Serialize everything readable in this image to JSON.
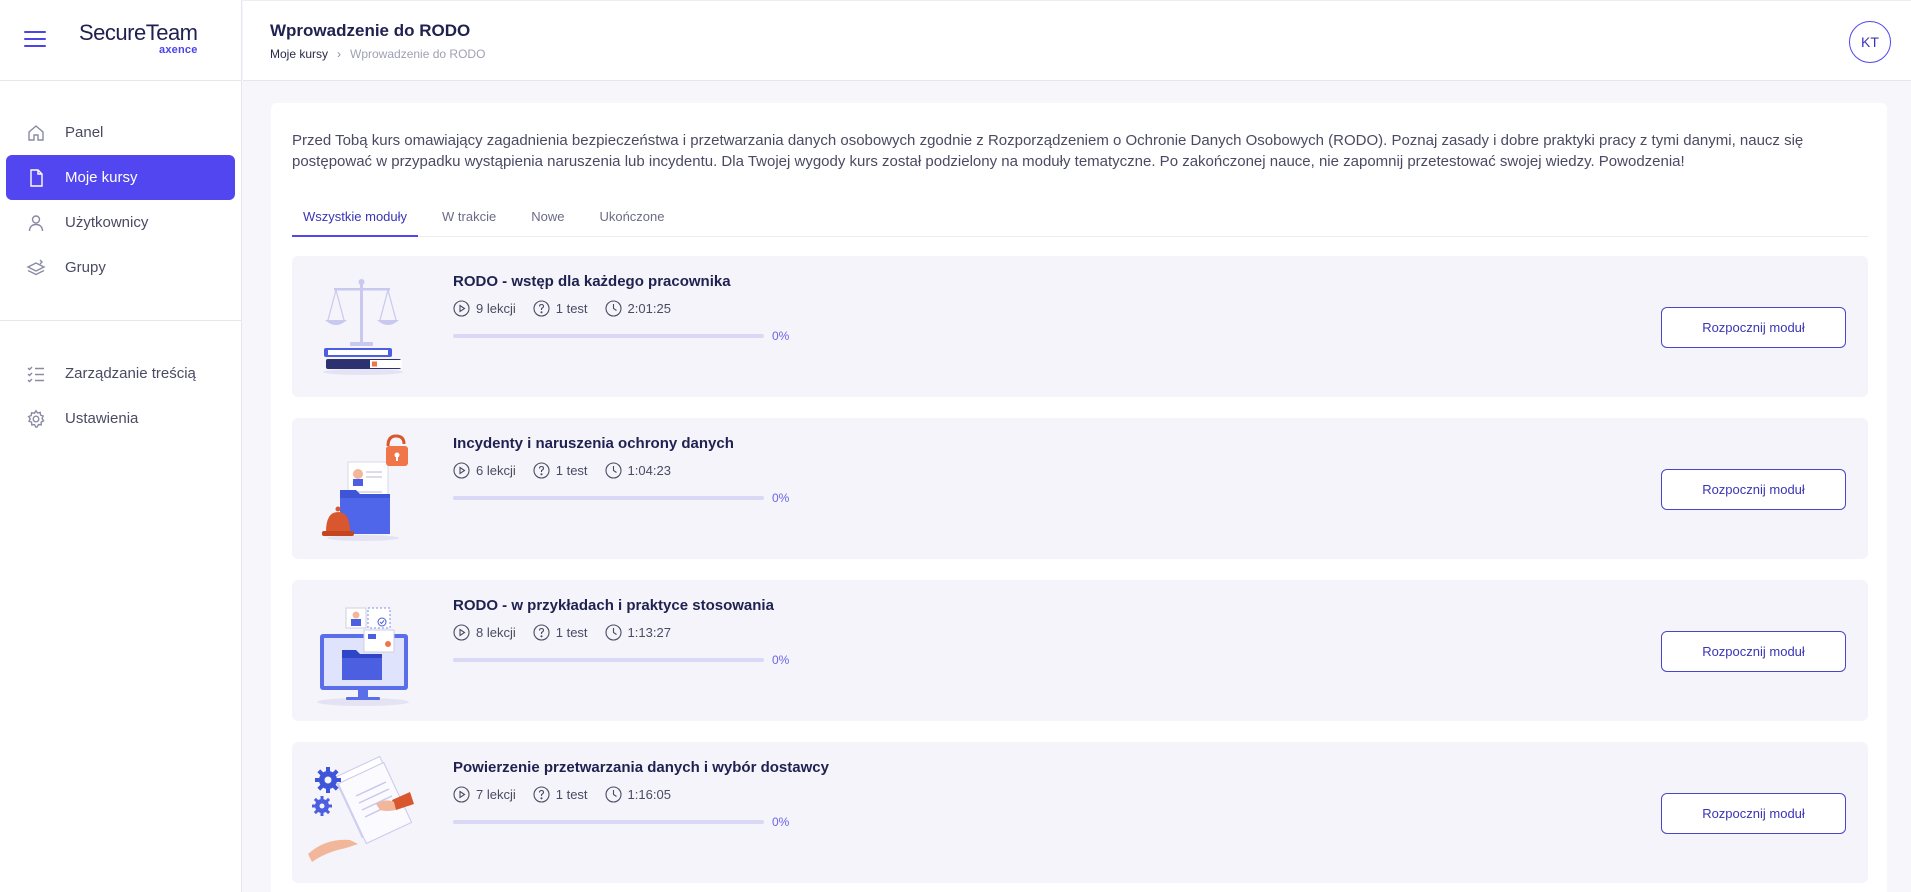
{
  "app": {
    "logo_main": "SecureTeam",
    "logo_sub": "axence"
  },
  "sidebar": {
    "items": [
      {
        "label": "Panel",
        "icon": "home-icon"
      },
      {
        "label": "Moje kursy",
        "icon": "document-icon",
        "active": true
      },
      {
        "label": "Użytkownicy",
        "icon": "user-icon"
      },
      {
        "label": "Grupy",
        "icon": "layers-icon"
      }
    ],
    "items2": [
      {
        "label": "Zarządzanie treścią",
        "icon": "list-check-icon"
      },
      {
        "label": "Ustawienia",
        "icon": "gear-icon"
      }
    ]
  },
  "header": {
    "title": "Wprowadzenie do RODO",
    "breadcrumb_root": "Moje kursy",
    "breadcrumb_sep": "›",
    "breadcrumb_current": "Wprowadzenie do RODO",
    "avatar_initials": "KT"
  },
  "main": {
    "intro": "Przed Tobą kurs omawiający zagadnienia bezpieczeństwa i przetwarzania danych osobowych zgodnie z Rozporządzeniem o Ochronie Danych Osobowych (RODO). Poznaj zasady i dobre praktyki pracy z tymi danymi, naucz się postępować w przypadku wystąpienia naruszenia lub incydentu. Dla Twojej wygody kurs został podzielony na moduły tematyczne. Po zakończonej nauce, nie zapomnij przetestować swojej wiedzy. Powodzenia!",
    "tabs": [
      "Wszystkie moduły",
      "W trakcie",
      "Nowe",
      "Ukończone"
    ],
    "modules": [
      {
        "title": "RODO - wstęp dla każdego pracownika",
        "lessons": "9 lekcji",
        "tests": "1 test",
        "duration": "2:01:25",
        "progress": 0,
        "progress_label": "0%",
        "button": "Rozpocznij moduł",
        "image": "scales-and-books-illustration"
      },
      {
        "title": "Incydenty i naruszenia ochrony danych",
        "lessons": "6 lekcji",
        "tests": "1 test",
        "duration": "1:04:23",
        "progress": 0,
        "progress_label": "0%",
        "button": "Rozpocznij moduł",
        "image": "folder-padlock-alarm-illustration"
      },
      {
        "title": "RODO - w przykładach i praktyce stosowania",
        "lessons": "8 lekcji",
        "tests": "1 test",
        "duration": "1:13:27",
        "progress": 0,
        "progress_label": "0%",
        "button": "Rozpocznij moduł",
        "image": "monitor-folder-illustration"
      },
      {
        "title": "Powierzenie przetwarzania danych i wybór dostawcy",
        "lessons": "7 lekcji",
        "tests": "1 test",
        "duration": "1:16:05",
        "progress": 0,
        "progress_label": "0%",
        "button": "Rozpocznij moduł",
        "image": "gears-document-handshake-illustration"
      }
    ]
  },
  "colors": {
    "accent": "#5146ef",
    "module_bg": "#f4f4fa",
    "page_bg": "#f6f6fb"
  }
}
